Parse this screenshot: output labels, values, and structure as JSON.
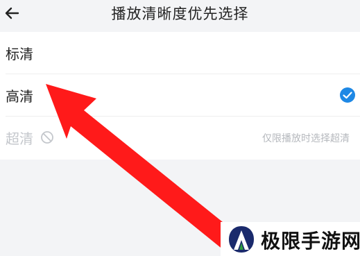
{
  "header": {
    "back_icon": "arrow-left-icon",
    "title": "播放清晰度优先选择"
  },
  "options": [
    {
      "label": "标清",
      "selected": false,
      "disabled": false
    },
    {
      "label": "高清",
      "selected": true,
      "disabled": false,
      "icon": "check-circle-icon"
    },
    {
      "label": "超清",
      "selected": false,
      "disabled": true,
      "icon": "forbidden-icon",
      "note": "仅限播放时选择超清"
    }
  ],
  "colors": {
    "accent": "#1e88e5",
    "arrow": "#ff1a1a",
    "disabled_text": "#c4c7cc"
  },
  "watermark": {
    "text": "极限手游网",
    "icon": "brand-logo"
  }
}
